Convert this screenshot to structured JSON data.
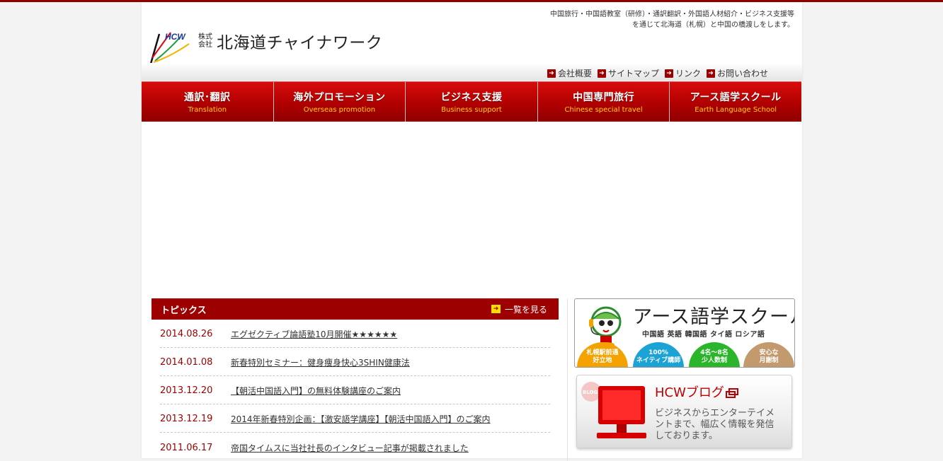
{
  "header": {
    "logo_mark_text": "HCW",
    "company_prefix": "株式会社",
    "company_name": "北海道チャイナワーク",
    "tagline_line1": "中国旅行・中国語教室（研修）・通訳翻訳・外国語人材紹介・ビジネス支援等",
    "tagline_line2": "を通じて北海道（札幌）と中国の橋渡しをします。"
  },
  "subnav": {
    "items": [
      {
        "label": "会社概要"
      },
      {
        "label": "サイトマップ"
      },
      {
        "label": "リンク"
      },
      {
        "label": "お問い合わせ"
      }
    ]
  },
  "mainnav": {
    "items": [
      {
        "ja": "通訳･翻訳",
        "en": "Translation"
      },
      {
        "ja": "海外プロモーション",
        "en": "Overseas promotion"
      },
      {
        "ja": "ビジネス支援",
        "en": "Business support"
      },
      {
        "ja": "中国専門旅行",
        "en": "Chinese special travel"
      },
      {
        "ja": "アース語学スクール",
        "en": "Earth Language School"
      }
    ]
  },
  "topics": {
    "title": "トピックス",
    "more_label": "一覧を見る",
    "items": [
      {
        "date": "2014.08.26",
        "title": "エグゼクティブ論語塾10月開催★★★★★★"
      },
      {
        "date": "2014.01.08",
        "title": "新春特別セミナー：健身痩身快心3SHIN健康法"
      },
      {
        "date": "2013.12.20",
        "title": "【朝活中国語入門】の無料体験講座のご案内"
      },
      {
        "date": "2013.12.19",
        "title": "2014年新春特別企画：【激安語学講座】【朝活中国語入門】のご案内"
      },
      {
        "date": "2011.06.17",
        "title": "帝国タイムスに当社社長のインタビュー記事が掲載されました"
      }
    ]
  },
  "school_banner": {
    "title": "アース語学スクール",
    "languages": "中国語 英語 韓国語 タイ語 ロシア語",
    "badges": [
      {
        "line1": "札幌駅前通",
        "line2": "好立地",
        "color": "#f3a200"
      },
      {
        "line1": "100%",
        "line2": "ネイティブ講師",
        "color": "#1aa3d4"
      },
      {
        "line1": "4名～8名",
        "line2": "少人数制",
        "color": "#2bb52b"
      },
      {
        "line1": "安心な",
        "line2": "月謝制",
        "color": "#c29a6e"
      }
    ]
  },
  "blog_banner": {
    "badge": "BLOG",
    "title": "HCWブログ",
    "text": "ビジネスからエンターテイメントまで、幅広く情報を発信しております。"
  },
  "colors": {
    "brand_red": "#9c0000",
    "nav_yellow": "#ffd200"
  }
}
